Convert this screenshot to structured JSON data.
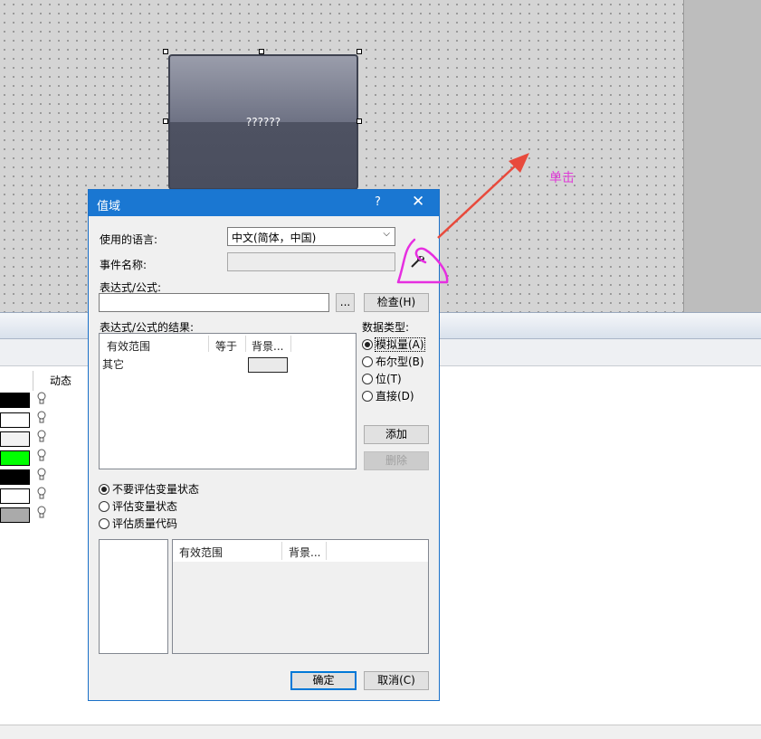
{
  "canvas": {
    "widget_text": "??????",
    "annotation": "单击"
  },
  "left_panel": {
    "dynamic_header": "动态",
    "swatch_colors": [
      "#000000",
      "#ffffff",
      "#f2f2f2",
      "#00ff00",
      "#000000",
      "#ffffff",
      "#aaaaaa"
    ]
  },
  "dialog": {
    "title": "值域",
    "help": "?",
    "close": "✕",
    "language_label": "使用的语言:",
    "language_value": "中文(简体，中国)",
    "event_label": "事件名称:",
    "expr_label": "表达式/公式:",
    "browse": "...",
    "check": "检查(H)",
    "result_label": "表达式/公式的结果:",
    "result_cols": [
      "有效范围",
      "等于",
      "背景..."
    ],
    "result_row": "其它",
    "datatype_label": "数据类型:",
    "datatypes": [
      "模拟量(A)",
      "布尔型(B)",
      "位(T)",
      "直接(D)"
    ],
    "add": "添加",
    "delete": "删除",
    "eval_options": [
      "不要评估变量状态",
      "评估变量状态",
      "评估质量代码"
    ],
    "bottom_cols": [
      "有效范围",
      "背景..."
    ],
    "ok": "确定",
    "cancel": "取消(C)"
  }
}
